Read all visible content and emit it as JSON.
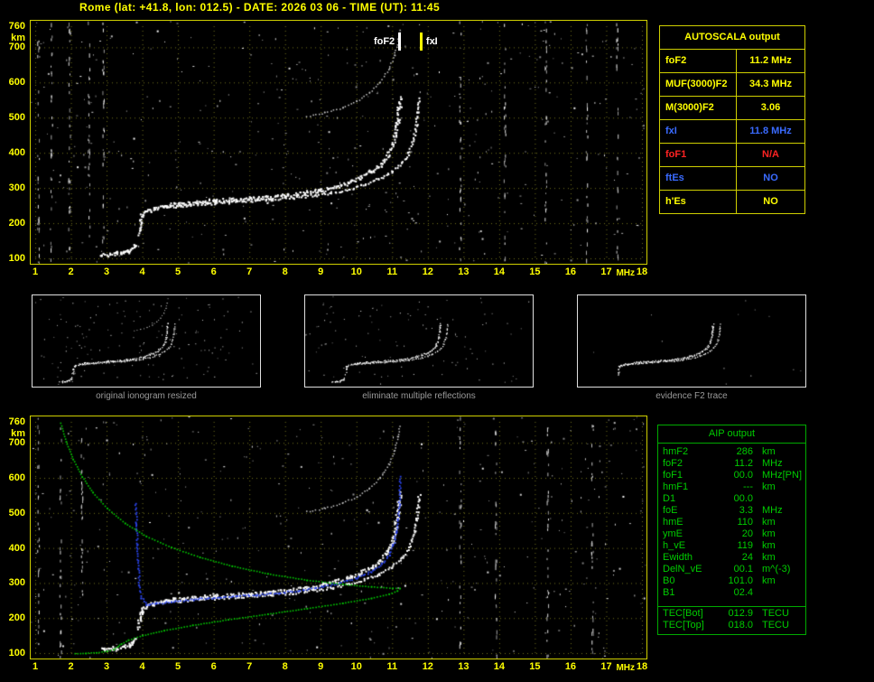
{
  "header": {
    "title": "Rome (lat: +41.8, lon: 012.5) - DATE: 2026 03 06 - TIME (UT): 11:45"
  },
  "colors": {
    "yellow": "#ffff00",
    "blue": "#3a6bff",
    "red": "#ff2323",
    "green": "#00cc00",
    "grid": "#73731c",
    "plot_border": "#cfcf00",
    "white": "#ffffff",
    "caption_gray": "#9a9a9a"
  },
  "autoscala": {
    "title": "AUTOSCALA output",
    "rows": [
      {
        "label": "foF2",
        "value": "11.2 MHz",
        "color": "yellow"
      },
      {
        "label": "MUF(3000)F2",
        "value": "34.3 MHz",
        "color": "yellow"
      },
      {
        "label": "M(3000)F2",
        "value": "3.06",
        "color": "yellow"
      },
      {
        "label": "fxI",
        "value": "11.8 MHz",
        "color": "blue"
      },
      {
        "label": "foF1",
        "value": "N/A",
        "color": "red"
      },
      {
        "label": "ftEs",
        "value": "NO",
        "color": "blue"
      },
      {
        "label": "h'Es",
        "value": "NO",
        "color": "yellow"
      }
    ]
  },
  "aip": {
    "title": "AIP output",
    "rows": [
      {
        "label": "hmF2",
        "value": "286",
        "unit": "km",
        "extra": ""
      },
      {
        "label": "foF2",
        "value": "11.2",
        "unit": "MHz",
        "extra": ""
      },
      {
        "label": "foF1",
        "value": "00.0",
        "unit": "MHz",
        "extra": "[PN]"
      },
      {
        "label": "hmF1",
        "value": "---",
        "unit": "km",
        "extra": ""
      },
      {
        "label": "D1",
        "value": "00.0",
        "unit": "",
        "extra": ""
      },
      {
        "label": "foE",
        "value": "3.3",
        "unit": "MHz",
        "extra": ""
      },
      {
        "label": "hmE",
        "value": "110",
        "unit": "km",
        "extra": ""
      },
      {
        "label": "ymE",
        "value": "20",
        "unit": "km",
        "extra": ""
      },
      {
        "label": "h_vE",
        "value": "119",
        "unit": "km",
        "extra": ""
      },
      {
        "label": "Ewidth",
        "value": "24",
        "unit": "km",
        "extra": ""
      },
      {
        "label": "DelN_vE",
        "value": "00.1",
        "unit": "m^(-3)",
        "extra": ""
      },
      {
        "label": "B0",
        "value": "101.0",
        "unit": "km",
        "extra": ""
      },
      {
        "label": "B1",
        "value": "02.4",
        "unit": "",
        "extra": ""
      }
    ],
    "tec_rows": [
      {
        "label": "TEC[Bot]",
        "value": "012.9",
        "unit": "TECU"
      },
      {
        "label": "TEC[Top]",
        "value": "018.0",
        "unit": "TECU"
      }
    ]
  },
  "chart_data": {
    "type": "scatter",
    "shared": {
      "xlim": [
        1,
        18
      ],
      "ylim": [
        100,
        760
      ],
      "xlabel": "MHz",
      "ylabel": "km",
      "xticks": [
        1,
        2,
        3,
        4,
        5,
        6,
        7,
        8,
        9,
        10,
        11,
        12,
        13,
        14,
        15,
        16,
        17,
        18
      ],
      "yticks": [
        760,
        700,
        600,
        500,
        400,
        300,
        200,
        100
      ],
      "traces": {
        "es": {
          "color": "#ffffff",
          "size": 2,
          "gap": 2,
          "jitter": 1.3,
          "dense": true,
          "points": [
            [
              2.85,
              112
            ],
            [
              3.05,
              113
            ],
            [
              3.25,
              115
            ],
            [
              3.45,
              118
            ],
            [
              3.6,
              123
            ],
            [
              3.72,
              131
            ],
            [
              3.8,
              141
            ]
          ]
        },
        "f_o": {
          "color": "#ffffff",
          "size": 2,
          "gap": 2.2,
          "jitter": 1.7,
          "dense": true,
          "points": [
            [
              3.88,
              172
            ],
            [
              3.93,
              208
            ],
            [
              3.99,
              228
            ],
            [
              4.1,
              236
            ],
            [
              4.3,
              243
            ],
            [
              4.6,
              250
            ],
            [
              5.0,
              256
            ],
            [
              5.5,
              261
            ],
            [
              6.0,
              265
            ],
            [
              6.5,
              268
            ],
            [
              7.0,
              271
            ],
            [
              7.5,
              275
            ],
            [
              8.0,
              280
            ],
            [
              8.5,
              287
            ],
            [
              9.0,
              296
            ],
            [
              9.4,
              306
            ],
            [
              9.8,
              318
            ],
            [
              10.1,
              331
            ],
            [
              10.4,
              347
            ],
            [
              10.65,
              366
            ],
            [
              10.85,
              391
            ],
            [
              11.0,
              422
            ],
            [
              11.08,
              455
            ],
            [
              11.14,
              492
            ],
            [
              11.18,
              528
            ],
            [
              11.2,
              558
            ]
          ]
        },
        "f_x": {
          "color": "#ffffff",
          "size": 2,
          "gap": 2.4,
          "jitter": 1.4,
          "dense": false,
          "points": [
            [
              4.6,
              247
            ],
            [
              5.2,
              252
            ],
            [
              5.8,
              257
            ],
            [
              6.4,
              261
            ],
            [
              7.0,
              265
            ],
            [
              7.6,
              269
            ],
            [
              8.2,
              274
            ],
            [
              8.8,
              281
            ],
            [
              9.3,
              289
            ],
            [
              9.8,
              299
            ],
            [
              10.2,
              311
            ],
            [
              10.6,
              327
            ],
            [
              10.95,
              347
            ],
            [
              11.25,
              372
            ],
            [
              11.45,
              402
            ],
            [
              11.58,
              438
            ],
            [
              11.66,
              478
            ],
            [
              11.71,
              520
            ],
            [
              11.74,
              556
            ]
          ]
        },
        "second_hop": {
          "color": "#c8c8c8",
          "size": 1.5,
          "gap": 3.5,
          "jitter": 0.7,
          "dense": false,
          "points": [
            [
              8.6,
              505
            ],
            [
              9.1,
              515
            ],
            [
              9.6,
              530
            ],
            [
              10.0,
              548
            ],
            [
              10.35,
              572
            ],
            [
              10.65,
              602
            ],
            [
              10.9,
              640
            ],
            [
              11.05,
              678
            ],
            [
              11.15,
              718
            ],
            [
              11.2,
              750
            ]
          ]
        },
        "synth_blue": {
          "color": "#2b45f0",
          "size": 1.8,
          "gap": 2.6,
          "jitter": 0.9,
          "dense": false,
          "points": [
            [
              3.8,
              530
            ],
            [
              3.82,
              470
            ],
            [
              3.84,
              410
            ],
            [
              3.87,
              345
            ],
            [
              3.9,
              295
            ],
            [
              3.96,
              260
            ],
            [
              4.1,
              241
            ],
            [
              4.4,
              243
            ],
            [
              4.8,
              249
            ],
            [
              5.4,
              255
            ],
            [
              6.0,
              260
            ],
            [
              6.6,
              264
            ],
            [
              7.2,
              268
            ],
            [
              7.8,
              273
            ],
            [
              8.4,
              280
            ],
            [
              9.0,
              290
            ],
            [
              9.5,
              301
            ],
            [
              10.0,
              316
            ],
            [
              10.4,
              334
            ],
            [
              10.7,
              357
            ],
            [
              10.9,
              381
            ],
            [
              11.02,
              411
            ],
            [
              11.1,
              446
            ],
            [
              11.15,
              486
            ],
            [
              11.18,
              526
            ],
            [
              11.2,
              566
            ],
            [
              11.21,
              606
            ]
          ]
        },
        "profile_green": {
          "color": "#00cc00",
          "size": 1.6,
          "gap": 3.2,
          "jitter": 0.2,
          "dense": false,
          "points": [
            [
              1.7,
              758
            ],
            [
              1.85,
              705
            ],
            [
              2.05,
              655
            ],
            [
              2.3,
              605
            ],
            [
              2.6,
              560
            ],
            [
              3.0,
              515
            ],
            [
              3.5,
              472
            ],
            [
              4.1,
              435
            ],
            [
              4.8,
              403
            ],
            [
              5.6,
              375
            ],
            [
              6.5,
              350
            ],
            [
              7.5,
              328
            ],
            [
              8.6,
              310
            ],
            [
              9.6,
              298
            ],
            [
              10.4,
              291
            ],
            [
              11.0,
              287
            ],
            [
              11.2,
              286
            ],
            [
              11.13,
              279
            ],
            [
              10.9,
              270
            ],
            [
              10.4,
              258
            ],
            [
              9.6,
              244
            ],
            [
              8.6,
              229
            ],
            [
              7.5,
              213
            ],
            [
              6.4,
              197
            ],
            [
              5.4,
              181
            ],
            [
              4.6,
              166
            ],
            [
              4.0,
              152
            ],
            [
              3.6,
              139
            ],
            [
              3.4,
              128
            ],
            [
              3.3,
              120
            ],
            [
              3.18,
              112
            ],
            [
              3.0,
              107
            ],
            [
              2.7,
              103
            ],
            [
              2.4,
              101
            ],
            [
              2.1,
              100
            ]
          ]
        }
      }
    },
    "charts": [
      {
        "id": "main_ionogram",
        "title": "",
        "traces": [
          "es",
          "f_o",
          "f_x",
          "second_hop"
        ],
        "noise": {
          "count": 420,
          "bands": [
            1.08,
            1.45,
            1.95,
            2.5,
            2.9,
            12.9,
            14.15,
            15.3,
            16.45,
            17.3
          ]
        },
        "markers": [
          {
            "x": 11.2,
            "label": "foF2",
            "bar_color": "#ffffff",
            "side": "left"
          },
          {
            "x": 11.8,
            "label": "fxI",
            "bar_color": "#ffff00",
            "side": "right"
          }
        ],
        "seed": 7
      },
      {
        "id": "profile_ionogram",
        "title": "",
        "traces": [
          "es",
          "f_o",
          "f_x",
          "second_hop",
          "synth_blue",
          "profile_green"
        ],
        "noise": {
          "count": 380,
          "bands": [
            1.08,
            1.7,
            2.3,
            12.9,
            13.9,
            15.35,
            16.6
          ]
        },
        "markers": [],
        "seed": 11
      }
    ],
    "thumbnails": [
      {
        "caption": "original ionogram resized",
        "traces": [
          "es",
          "f_o",
          "f_x",
          "second_hop"
        ],
        "noise": 150,
        "seed": 21
      },
      {
        "caption": "eliminate multiple reflections",
        "traces": [
          "es",
          "f_o",
          "f_x"
        ],
        "noise": 110,
        "seed": 22
      },
      {
        "caption": "evidence F2 trace",
        "traces": [
          "f_o",
          "f_x"
        ],
        "noise": 12,
        "seed": 23
      }
    ]
  }
}
